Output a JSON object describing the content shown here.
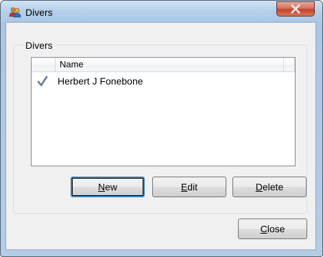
{
  "window": {
    "title": "Divers"
  },
  "group": {
    "label": "Divers"
  },
  "list": {
    "columns": [
      {
        "label": ""
      },
      {
        "label": "Name"
      },
      {
        "label": ""
      }
    ],
    "rows": [
      {
        "icon": "checkmark-icon",
        "name": "Herbert J Fonebone"
      }
    ]
  },
  "buttons": {
    "new": {
      "mnemonic": "N",
      "rest": "ew"
    },
    "edit": {
      "mnemonic": "E",
      "rest": "dit"
    },
    "delete": {
      "mnemonic": "D",
      "rest": "elete"
    },
    "close": {
      "mnemonic": "C",
      "rest": "lose"
    }
  },
  "colors": {
    "title_close_red": "#c2432c",
    "window_frame": "#b4cfe9",
    "dialog_bg": "#f0f0f0"
  }
}
